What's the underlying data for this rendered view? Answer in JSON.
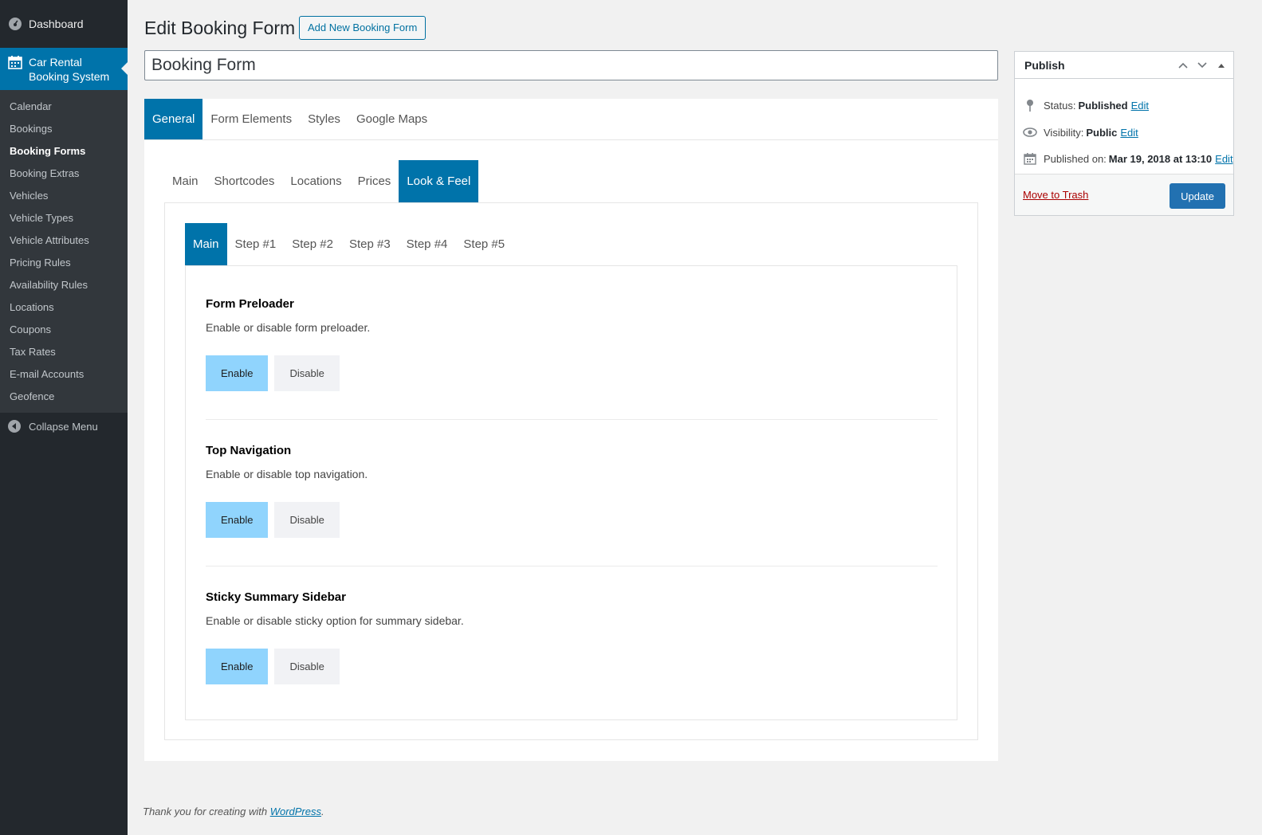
{
  "sidebar": {
    "dashboard": "Dashboard",
    "plugin_line1": "Car Rental",
    "plugin_line2": "Booking System",
    "items": [
      "Calendar",
      "Bookings",
      "Booking Forms",
      "Booking Extras",
      "Vehicles",
      "Vehicle Types",
      "Vehicle Attributes",
      "Pricing Rules",
      "Availability Rules",
      "Locations",
      "Coupons",
      "Tax Rates",
      "E-mail Accounts",
      "Geofence"
    ],
    "current_item": "Booking Forms",
    "collapse": "Collapse Menu"
  },
  "header": {
    "title": "Edit Booking Form",
    "add_new": "Add New Booking Form"
  },
  "post_title": "Booking Form",
  "tabs_top": [
    "General",
    "Form Elements",
    "Styles",
    "Google Maps"
  ],
  "tabs_second": [
    "Main",
    "Shortcodes",
    "Locations",
    "Prices",
    "Look & Feel"
  ],
  "tabs_third": [
    "Main",
    "Step #1",
    "Step #2",
    "Step #3",
    "Step #4",
    "Step #5"
  ],
  "options": [
    {
      "title": "Form Preloader",
      "desc": "Enable or disable form preloader.",
      "enable": "Enable",
      "disable": "Disable"
    },
    {
      "title": "Top Navigation",
      "desc": "Enable or disable top navigation.",
      "enable": "Enable",
      "disable": "Disable"
    },
    {
      "title": "Sticky Summary Sidebar",
      "desc": "Enable or disable sticky option for summary sidebar.",
      "enable": "Enable",
      "disable": "Disable"
    }
  ],
  "publish": {
    "title": "Publish",
    "status_label": "Status:",
    "status_value": "Published",
    "visibility_label": "Visibility:",
    "visibility_value": "Public",
    "published_label": "Published on:",
    "published_value": "Mar 19, 2018 at 13:10",
    "edit": "Edit",
    "trash": "Move to Trash",
    "update": "Update"
  },
  "footer": {
    "text": "Thank you for creating with ",
    "link": "WordPress",
    "end": "."
  },
  "colors": {
    "admin_blue": "#0073aa",
    "sidebar_bg": "#23282d",
    "enable_bg": "#90d4fd"
  }
}
